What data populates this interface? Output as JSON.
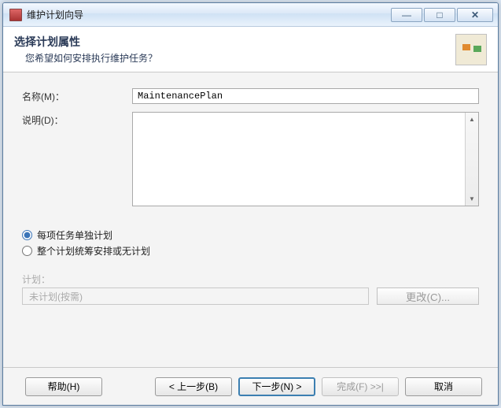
{
  "window": {
    "title": "维护计划向导"
  },
  "header": {
    "title": "选择计划属性",
    "subtitle": "您希望如何安排执行维护任务？"
  },
  "form": {
    "name_label": "名称(M)：",
    "name_value": "MaintenancePlan",
    "desc_label": "说明(D)：",
    "desc_value": ""
  },
  "schedule_mode": {
    "per_task": "每项任务单独计划",
    "single": "整个计划统筹安排或无计划",
    "selected": "per_task"
  },
  "schedule": {
    "label": "计划：",
    "value": "未计划(按需)",
    "change_btn": "更改(C)..."
  },
  "footer": {
    "help": "帮助(H)",
    "back": "< 上一步(B)",
    "next": "下一步(N) >",
    "finish": "完成(F) >>|",
    "cancel": "取消"
  }
}
